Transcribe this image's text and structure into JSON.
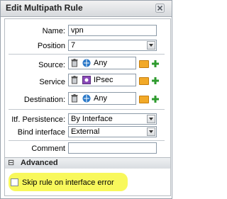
{
  "dialog": {
    "title": "Edit Multipath Rule"
  },
  "form": {
    "name_label": "Name:",
    "name_value": "vpn",
    "position_label": "Position",
    "position_value": "7",
    "source_label": "Source:",
    "source_value": "Any",
    "service_label": "Service",
    "service_value": "IPsec",
    "destination_label": "Destination:",
    "destination_value": "Any",
    "itf_persistence_label": "Itf. Persistence:",
    "itf_persistence_value": "By Interface",
    "bind_interface_label": "Bind interface",
    "bind_interface_value": "External",
    "comment_label": "Comment",
    "comment_value": ""
  },
  "advanced": {
    "section_label": "Advanced",
    "toggle_symbol": "⊟",
    "skip_rule_label": "Skip rule on interface error",
    "skip_rule_checked": false
  },
  "colors": {
    "highlight": "#f7f74a",
    "folder": "#f2a928",
    "plus": "#2e9b2e",
    "network_icon": "#2a78c8"
  }
}
